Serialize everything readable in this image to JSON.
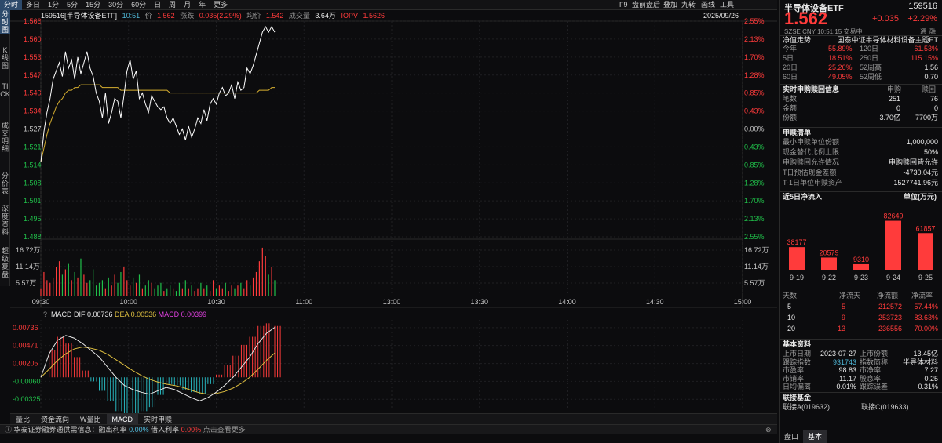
{
  "topbar": {
    "tabs": [
      "分时",
      "多日",
      "1分",
      "5分",
      "15分",
      "30分",
      "60分",
      "日",
      "周",
      "月",
      "年",
      "更多"
    ],
    "active": 0,
    "right": [
      "F9",
      "盘前盘后",
      "叠加",
      "九转",
      "画线",
      "工具"
    ]
  },
  "lefttabs": [
    {
      "label": "分时图",
      "active": true
    },
    {
      "label": "K线图",
      "active": false
    },
    {
      "label": "TICK",
      "active": false
    },
    {
      "label": "成交明细",
      "active": false
    },
    {
      "label": "分价表",
      "active": false
    },
    {
      "label": "深度资料",
      "active": false
    },
    {
      "label": "超级复盘",
      "active": false
    }
  ],
  "info": {
    "code_name": "159516[半导体设备ETF]",
    "time": "10:51",
    "price_label": "价",
    "price": "1.562",
    "chg_label": "涨跌",
    "chg": "0.035(2.29%)",
    "avg_label": "均价",
    "avg": "1.542",
    "vol_label": "成交量",
    "vol": "3.64万",
    "iopv_label": "IOPV",
    "iopv": "1.5626",
    "date": "2025/09/26"
  },
  "chart_data": {
    "type": "line",
    "x_ticks": [
      "09:30",
      "10:00",
      "10:30",
      "11:00",
      "13:00",
      "13:30",
      "14:00",
      "14:30",
      "15:00"
    ],
    "price_ticks": [
      "1.566",
      "1.560",
      "1.553",
      "1.547",
      "1.540",
      "1.534",
      "1.527",
      "1.521",
      "1.514",
      "1.508",
      "1.501",
      "1.495",
      "1.488"
    ],
    "pct_ticks": [
      "2.55%",
      "2.13%",
      "1.70%",
      "1.28%",
      "0.85%",
      "0.43%",
      "0.00%",
      "0.43%",
      "0.85%",
      "1.28%",
      "1.70%",
      "2.13%",
      "2.55%"
    ],
    "ylim": [
      1.488,
      1.566
    ],
    "prev_close": 1.527,
    "series": [
      {
        "name": "价",
        "values": [
          1.515,
          1.526,
          1.533,
          1.538,
          1.545,
          1.548,
          1.551,
          1.546,
          1.555,
          1.549,
          1.552,
          1.545,
          1.553,
          1.547,
          1.551,
          1.555,
          1.549,
          1.546,
          1.54,
          1.537,
          1.531,
          1.54,
          1.529,
          1.533,
          1.538,
          1.537,
          1.531,
          1.539,
          1.548,
          1.552,
          1.545,
          1.548,
          1.538,
          1.54,
          1.536,
          1.533,
          1.539,
          1.537,
          1.535,
          1.534,
          1.535,
          1.531,
          1.529,
          1.531,
          1.528,
          1.525,
          1.527,
          1.523,
          1.528,
          1.524,
          1.527,
          1.531,
          1.529,
          1.534,
          1.53,
          1.536,
          1.538,
          1.536,
          1.54,
          1.542,
          1.539,
          1.54,
          1.543,
          1.538,
          1.544,
          1.541,
          1.542,
          1.549,
          1.547,
          1.55,
          1.554,
          1.558,
          1.562,
          1.564,
          1.562,
          1.564,
          1.562
        ]
      },
      {
        "name": "均价",
        "values": [
          1.515,
          1.52,
          1.525,
          1.529,
          1.532,
          1.535,
          1.537,
          1.538,
          1.54,
          1.541,
          1.541,
          1.542,
          1.542,
          1.543,
          1.543,
          1.543,
          1.543,
          1.543,
          1.543,
          1.543,
          1.542,
          1.542,
          1.542,
          1.542,
          1.542,
          1.542,
          1.541,
          1.541,
          1.541,
          1.541,
          1.541,
          1.541,
          1.541,
          1.541,
          1.541,
          1.541,
          1.541,
          1.541,
          1.541,
          1.541,
          1.541,
          1.541,
          1.54,
          1.54,
          1.54,
          1.54,
          1.54,
          1.54,
          1.54,
          1.54,
          1.54,
          1.54,
          1.54,
          1.54,
          1.54,
          1.54,
          1.54,
          1.54,
          1.54,
          1.54,
          1.54,
          1.54,
          1.54,
          1.54,
          1.54,
          1.54,
          1.54,
          1.54,
          1.54,
          1.54,
          1.54,
          1.541,
          1.541,
          1.541,
          1.541,
          1.542,
          1.542
        ]
      }
    ],
    "vol_ticks": [
      "16.72万",
      "11.14万",
      "5.57万"
    ],
    "volume": [
      3,
      9,
      6,
      5,
      7,
      11,
      13,
      8,
      10,
      12,
      6,
      9,
      7,
      14,
      8,
      5,
      6,
      10,
      4,
      5,
      6,
      3,
      7,
      4,
      8,
      5,
      9,
      11,
      6,
      4,
      7,
      5,
      8,
      3,
      4,
      6,
      5,
      3,
      4,
      5,
      2,
      3,
      4,
      3,
      2,
      5,
      3,
      6,
      3,
      4,
      2,
      3,
      5,
      3,
      4,
      2,
      6,
      3,
      4,
      3,
      5,
      2,
      4,
      3,
      4,
      5,
      3,
      6,
      4,
      7,
      9,
      13,
      18,
      15,
      8,
      11,
      6
    ],
    "macd": {
      "label": "MACD",
      "dif_label": "DIF",
      "dif": "0.00736",
      "dea_label": "DEA",
      "dea": "0.00536",
      "macd_label": "MACD",
      "macd_val": "0.00399",
      "ticks": [
        "0.00736",
        "0.00471",
        "0.00205",
        "-0.00060",
        "-0.00325"
      ],
      "dif_series": [
        0.0,
        0.0035,
        0.0055,
        0.0062,
        0.0058,
        0.005,
        0.004,
        0.003,
        0.0015,
        0.0,
        -0.0012,
        -0.0018,
        -0.0022,
        -0.0025,
        -0.002,
        -0.0015,
        -0.0018,
        -0.0024,
        -0.003,
        -0.0035,
        -0.003,
        -0.0022,
        -0.0012,
        0.0,
        0.0015,
        0.003,
        0.005,
        0.0065,
        0.0074
      ],
      "dea_series": [
        0.0,
        0.0012,
        0.0025,
        0.0035,
        0.0042,
        0.0045,
        0.0043,
        0.004,
        0.0034,
        0.0026,
        0.0018,
        0.001,
        0.0003,
        -0.0003,
        -0.0007,
        -0.001,
        -0.0012,
        -0.0015,
        -0.0019,
        -0.0023,
        -0.0025,
        -0.0024,
        -0.0021,
        -0.0016,
        -0.0009,
        0.0,
        0.0012,
        0.0025,
        0.0036
      ],
      "bars": [
        0.0,
        0.004,
        0.006,
        0.005,
        0.003,
        0.001,
        -0.0006,
        -0.002,
        -0.0035,
        -0.005,
        -0.006,
        -0.0056,
        -0.005,
        -0.0044,
        -0.0026,
        -0.001,
        -0.0012,
        -0.0018,
        -0.0022,
        -0.0024,
        -0.001,
        0.0004,
        0.0018,
        0.0032,
        0.0048,
        0.006,
        0.0076,
        0.008,
        0.0076
      ]
    },
    "volume_ylim": [
      0,
      20
    ]
  },
  "bottomtabs": [
    "量比",
    "资金流向",
    "W量比",
    "MACD",
    "实时申赎"
  ],
  "bottom_active": 3,
  "ticker": {
    "text": "华泰证券融券通供需信息：融出利率",
    "rate1": "0.00%",
    "mid": "借入利率",
    "rate2": "0.00%",
    "tail": "点击查看更多"
  },
  "panel": {
    "name": "半导体设备ETF",
    "code": "159516",
    "price": "1.562",
    "chg": "+0.035",
    "pct": "+2.29%",
    "meta": "SZSE  CNY  10:51:15 交易中",
    "meta_tags": [
      "通",
      "融"
    ],
    "nav_label": "净值走势",
    "nav_desc": "国泰中证半导体材料设备主题ET",
    "perf": [
      {
        "k1": "今年",
        "v1": "55.89%",
        "k2": "120日",
        "v2": "61.53%"
      },
      {
        "k1": "5日",
        "v1": "18.51%",
        "k2": "250日",
        "v2": "115.15%"
      },
      {
        "k1": "20日",
        "v1": "25.26%",
        "k2": "52周高",
        "v2": "1.56"
      },
      {
        "k1": "60日",
        "v1": "49.05%",
        "k2": "52周低",
        "v2": "0.70"
      }
    ],
    "sr_title": "实时申购赎回信息",
    "sr_h1": "申购",
    "sr_h2": "赎回",
    "sr_rows": [
      {
        "k": "笔数",
        "a": "251",
        "b": "76"
      },
      {
        "k": "金额",
        "a": "0",
        "b": "0"
      },
      {
        "k": "份额",
        "a": "3.70亿",
        "b": "7700万"
      }
    ],
    "list_title": "申赎清单",
    "list_rows": [
      {
        "k": "最小申赎单位份额",
        "v": "1,000,000"
      },
      {
        "k": "现金替代比例上限",
        "v": "50%"
      },
      {
        "k": "申购赎回允许情况",
        "v": "申购赎回皆允许"
      },
      {
        "k": "T日预估现金差额",
        "v": "-4730.04元"
      },
      {
        "k": "T-1日单位申赎资产",
        "v": "1527741.96元"
      }
    ],
    "flow_title": "近5日净流入",
    "flow_unit": "单位(万元)",
    "flow": {
      "dates": [
        "9-19",
        "9-22",
        "9-23",
        "9-24",
        "9-25"
      ],
      "values": [
        38177,
        20579,
        9310,
        82649,
        61857
      ],
      "labels": [
        "38177",
        "20579",
        "9310",
        "82649",
        "61857"
      ]
    },
    "flow_table": {
      "headers": [
        "天数",
        "净流天",
        "净流额",
        "净流率"
      ],
      "rows": [
        [
          "5",
          "5",
          "212572",
          "57.44%"
        ],
        [
          "10",
          "9",
          "253723",
          "83.63%"
        ],
        [
          "20",
          "13",
          "236556",
          "70.00%"
        ]
      ]
    },
    "basic_title": "基本资料",
    "basic_rows": [
      {
        "k1": "上市日期",
        "v1": "2023-07-27",
        "k2": "上市份额",
        "v2": "13.45亿"
      },
      {
        "k1": "跟踪指数",
        "v1": "931743",
        "k2": "指数简称",
        "v2": "半导体材料"
      },
      {
        "k1": "市盈率",
        "v1": "98.83",
        "k2": "市净率",
        "v2": "7.27"
      },
      {
        "k1": "市销率",
        "v1": "11.17",
        "k2": "股息率",
        "v2": "0.25"
      },
      {
        "k1": "日均偏离",
        "v1": "0.01%",
        "k2": "跟踪误差",
        "v2": "0.31%"
      }
    ],
    "link_title": "联接基金",
    "link_a": "联接A(019632)",
    "link_c": "联接C(019633)",
    "tabs": [
      "盘口",
      "基本"
    ],
    "tab_active": 1
  },
  "colors": {
    "up": "#ff3b3b",
    "down": "#20c04a",
    "price_line": "#ffffff",
    "avg_line": "#d8b030",
    "grid": "#2a2a2a"
  }
}
